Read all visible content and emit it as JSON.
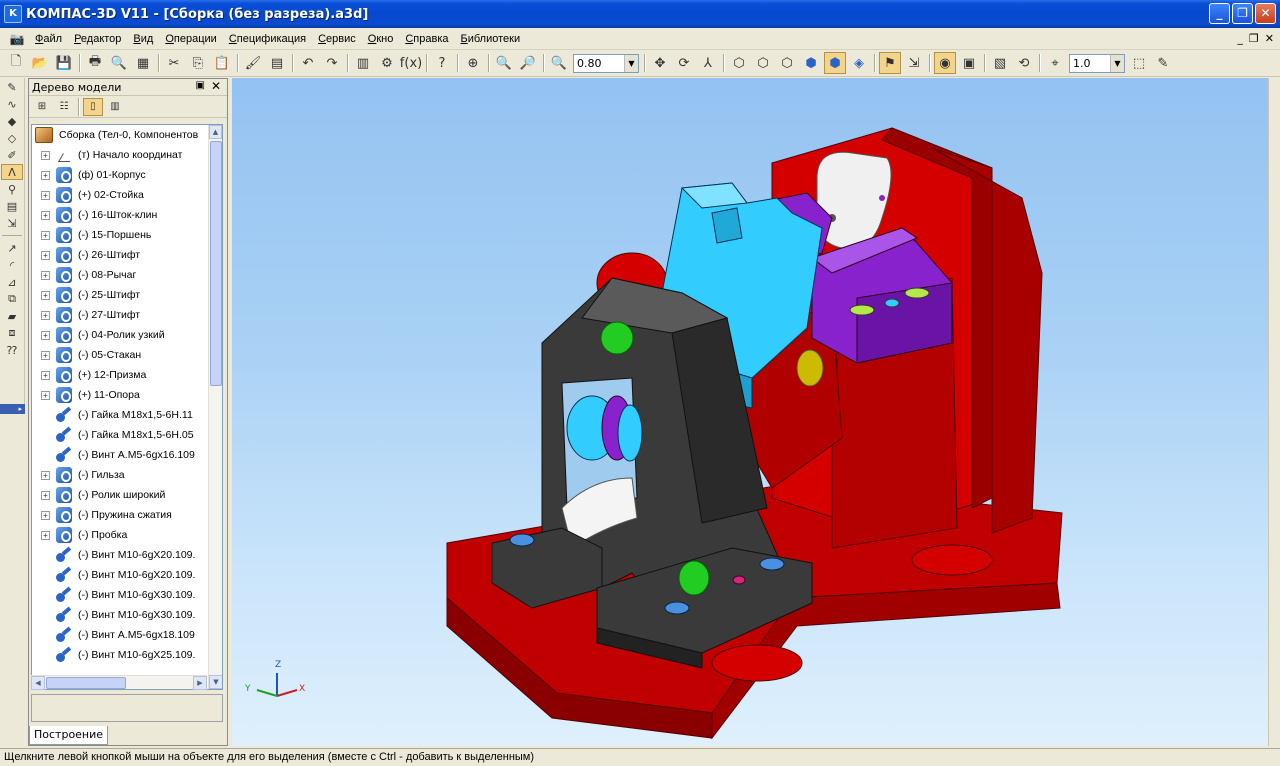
{
  "window": {
    "title": "КОМПАС-3D V11 - [Сборка (без разреза).a3d]",
    "app_icon": "kompas-logo-icon",
    "buttons": [
      "_",
      "❐",
      "✕"
    ]
  },
  "menu": {
    "items": [
      "Файл",
      "Редактор",
      "Вид",
      "Операции",
      "Спецификация",
      "Сервис",
      "Окно",
      "Справка",
      "Библиотеки"
    ],
    "mdi_buttons": [
      "_",
      "❐",
      "✕"
    ]
  },
  "toolbar": {
    "zoom_value": "0.80",
    "step_value": "1.0"
  },
  "tree": {
    "title": "Дерево модели",
    "root_label": "Сборка (Тел-0, Компонентов",
    "items": [
      {
        "label": "(т) Начало координат",
        "type": "origin",
        "expand": true
      },
      {
        "label": "(ф) 01-Корпус",
        "type": "part",
        "expand": true
      },
      {
        "label": "(+) 02-Стойка",
        "type": "part",
        "expand": true
      },
      {
        "label": "(-) 16-Шток-клин",
        "type": "part",
        "expand": true
      },
      {
        "label": "(-) 15-Поршень",
        "type": "part",
        "expand": true
      },
      {
        "label": "(-) 26-Штифт",
        "type": "part",
        "expand": true
      },
      {
        "label": "(-) 08-Рычаг",
        "type": "part",
        "expand": true
      },
      {
        "label": "(-) 25-Штифт",
        "type": "part",
        "expand": true
      },
      {
        "label": "(-) 27-Штифт",
        "type": "part",
        "expand": true
      },
      {
        "label": "(-) 04-Ролик узкий",
        "type": "part",
        "expand": true
      },
      {
        "label": "(-) 05-Стакан",
        "type": "part",
        "expand": true
      },
      {
        "label": "(+) 12-Призма",
        "type": "part",
        "expand": true
      },
      {
        "label": "(+) 11-Опора",
        "type": "part",
        "expand": true
      },
      {
        "label": "(-) Гайка M18x1,5-6H.11",
        "type": "std",
        "expand": false
      },
      {
        "label": "(-) Гайка M18x1,5-6H.05",
        "type": "std",
        "expand": false
      },
      {
        "label": "(-) Винт А.М5-6gx16.109",
        "type": "std",
        "expand": false
      },
      {
        "label": "(-) Гильза",
        "type": "part",
        "expand": true
      },
      {
        "label": "(-) Ролик широкий",
        "type": "part",
        "expand": true
      },
      {
        "label": "(-) Пружина сжатия",
        "type": "part",
        "expand": true
      },
      {
        "label": "(-) Пробка",
        "type": "part",
        "expand": true
      },
      {
        "label": "(-) Винт М10-6gX20.109.",
        "type": "std",
        "expand": false
      },
      {
        "label": "(-) Винт М10-6gX20.109.",
        "type": "std",
        "expand": false
      },
      {
        "label": "(-) Винт М10-6gX30.109.",
        "type": "std",
        "expand": false
      },
      {
        "label": "(-) Винт М10-6gX30.109.",
        "type": "std",
        "expand": false
      },
      {
        "label": "(-) Винт А.М5-6gx18.109",
        "type": "std",
        "expand": false
      },
      {
        "label": "(-) Винт М10-6gX25.109.",
        "type": "std",
        "expand": false
      }
    ],
    "tab_label": "Построение"
  },
  "axes": {
    "z": "Z",
    "y": "Y",
    "x": "X"
  },
  "status": {
    "text": "Щелкните левой кнопкой мыши на объекте для его выделения (вместе с Ctrl - добавить к выделенным)"
  },
  "colors": {
    "red": "#d40000",
    "dark_red": "#8c0000",
    "cyan": "#33ccff",
    "purple": "#8822cc",
    "dark_gray": "#3a3a3a",
    "green": "#22cc22",
    "yellow": "#ccbb00"
  }
}
